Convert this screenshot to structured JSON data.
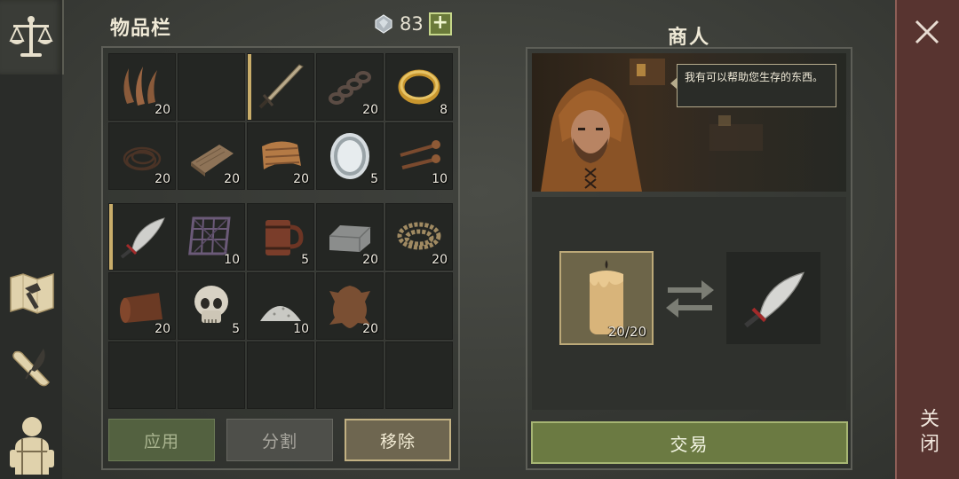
{
  "inventory": {
    "title": "物品栏",
    "currency_icon": "gem-icon",
    "currency": "83",
    "add_label": "+",
    "bag_rows": [
      [
        {
          "icon": "tendon-fiber-icon",
          "qty": "20"
        },
        {
          "icon": "",
          "qty": ""
        },
        {
          "icon": "sword-icon",
          "qty": ""
        },
        {
          "icon": "chain-icon",
          "qty": "20"
        },
        {
          "icon": "gold-ring-icon",
          "qty": "8"
        }
      ],
      [
        {
          "icon": "rope-coil-icon",
          "qty": "20"
        },
        {
          "icon": "wooden-plank-icon",
          "qty": "20"
        },
        {
          "icon": "bark-strips-icon",
          "qty": "20"
        },
        {
          "icon": "mirror-icon",
          "qty": "5"
        },
        {
          "icon": "nails-icon",
          "qty": "10"
        }
      ]
    ],
    "stash_rows": [
      [
        {
          "icon": "scimitar-icon",
          "qty": ""
        },
        {
          "icon": "iron-grate-icon",
          "qty": "10"
        },
        {
          "icon": "wooden-mug-icon",
          "qty": "5"
        },
        {
          "icon": "stone-block-icon",
          "qty": "20"
        },
        {
          "icon": "thick-rope-icon",
          "qty": "20"
        }
      ],
      [
        {
          "icon": "leather-roll-icon",
          "qty": "20"
        },
        {
          "icon": "skull-icon",
          "qty": "5"
        },
        {
          "icon": "salt-pile-icon",
          "qty": "10"
        },
        {
          "icon": "animal-hide-icon",
          "qty": "20"
        },
        {
          "icon": "",
          "qty": ""
        }
      ],
      [
        {
          "icon": "",
          "qty": ""
        },
        {
          "icon": "",
          "qty": ""
        },
        {
          "icon": "",
          "qty": ""
        },
        {
          "icon": "",
          "qty": ""
        },
        {
          "icon": "",
          "qty": ""
        }
      ]
    ],
    "buttons": {
      "apply": "应用",
      "split": "分割",
      "remove": "移除"
    }
  },
  "merchant": {
    "title": "商人",
    "speech": "我有可以帮助您生存的东西。",
    "offer": {
      "icon": "candle-icon",
      "qty": "20/20"
    },
    "want": {
      "icon": "scimitar-icon"
    },
    "trade_label": "交易"
  },
  "close": {
    "label": "关闭"
  },
  "sidebar": {
    "tabs": [
      "scales-icon",
      "map-hammer-icon",
      "scroll-quill-icon",
      "character-icon"
    ]
  },
  "colors": {
    "accent_green": "#6b7a42",
    "close_red": "#583430",
    "highlight_gold": "#c9ad6a"
  }
}
